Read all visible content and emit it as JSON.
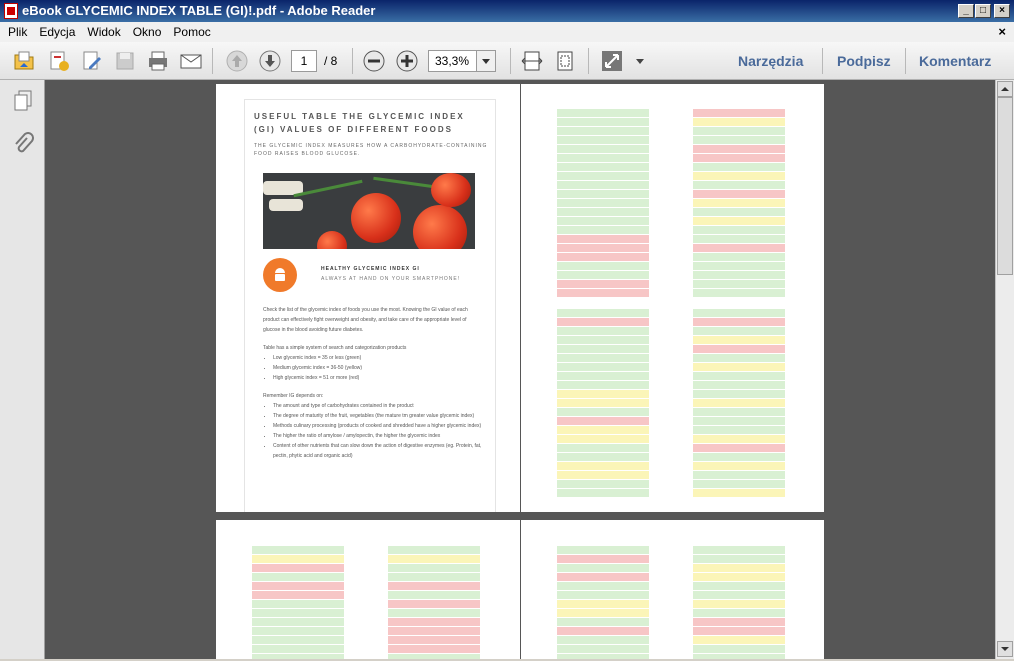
{
  "window": {
    "title": "eBook GLYCEMIC INDEX TABLE (GI)!.pdf - Adobe Reader",
    "minimize": "_",
    "maximize": "□",
    "close": "×"
  },
  "menu": {
    "items": [
      "Plik",
      "Edycja",
      "Widok",
      "Okno",
      "Pomoc"
    ],
    "doc_close": "×"
  },
  "toolbar": {
    "page_current": "1",
    "page_total": "/ 8",
    "zoom": "33,3%",
    "tools_label": "Narzędzia",
    "sign_label": "Podpisz",
    "comment_label": "Komentarz"
  },
  "icons": {
    "open": "open-icon",
    "create": "create-pdf-icon",
    "edit": "edit-icon",
    "save": "save-icon",
    "print": "print-icon",
    "email": "email-icon",
    "prev_page": "arrow-up-icon",
    "next_page": "arrow-down-icon",
    "zoom_out": "minus-icon",
    "zoom_in": "plus-icon",
    "fit_page": "fit-page-icon",
    "fit_width": "fit-width-icon",
    "fullscreen": "fullscreen-icon",
    "more": "chevron-down-icon",
    "pages_panel": "pages-icon",
    "attachments": "paperclip-icon"
  },
  "colors": {
    "green": "#d9f0d3",
    "yellow": "#fbf5b8",
    "red": "#f7c6c6",
    "accent": "#f07a2a",
    "link": "#4a6a9a"
  },
  "document": {
    "title": "USEFUL TABLE THE GLYCEMIC INDEX (GI) VALUES OF DIFFERENT FOODS",
    "subtitle": "THE GLYCEMIC INDEX MEASURES HOW A CARBOHYDRATE-CONTAINING FOOD RAISES BLOOD GLUCOSE.",
    "app_line1": "HEALTHY GLYCEMIC INDEX GI",
    "app_line2": "ALWAYS AT HAND ON YOUR SMARTPHONE!",
    "intro": "Check the list of the glycemic index of foods you use the most. Knowing the GI value of each product can effectively fight overweight and obesity, and take care of the appropriate level of glucose in the blood avoiding future diabetes.",
    "system_intro": "Table has a simple system of search and categorization products",
    "system_items": [
      "Low glycemic index = 35 or less (green)",
      "Medium glycemic index = 36-50 (yellow)",
      "High glycemic index = 51 or more (red)"
    ],
    "remember_intro": "Remember IG depends on:",
    "remember_items": [
      "The amount and type of carbohydrates contained in the product",
      "The degree of maturity of the fruit, vegetables (the mature tm greater value glycemic index)",
      "Methods culinary processing (products of cooked and shredded have a higher glycemic index)",
      "The higher the ratio of amylose / amylopectin, the higher the glycemic index",
      "Content of other nutrients that can slow down the action of digestive enzymes (eg. Protein, fat, pectin, phytic acid and organic acid)"
    ]
  },
  "tables": [
    {
      "id": "p2a",
      "rows": [
        "g",
        "g",
        "g",
        "g",
        "g",
        "g",
        "g",
        "g",
        "g",
        "g",
        "g",
        "g",
        "g",
        "g",
        "r",
        "r",
        "r",
        "g",
        "g",
        "r",
        "r"
      ]
    },
    {
      "id": "p2b",
      "rows": [
        "r",
        "y",
        "g",
        "g",
        "r",
        "r",
        "g",
        "y",
        "g",
        "r",
        "y",
        "g",
        "y",
        "g",
        "g",
        "r",
        "g",
        "g",
        "g",
        "g",
        "g"
      ]
    },
    {
      "id": "p3a",
      "rows": [
        "g",
        "r",
        "g",
        "g",
        "g",
        "g",
        "g",
        "g",
        "g",
        "y",
        "y",
        "g",
        "r",
        "y",
        "y",
        "g",
        "g",
        "y",
        "y",
        "g",
        "g"
      ]
    },
    {
      "id": "p3b",
      "rows": [
        "g",
        "r",
        "g",
        "y",
        "r",
        "g",
        "y",
        "g",
        "g",
        "g",
        "y",
        "g",
        "g",
        "g",
        "y",
        "r",
        "g",
        "y",
        "g",
        "g",
        "y"
      ]
    },
    {
      "id": "p4a",
      "rows": [
        "g",
        "y",
        "r",
        "g",
        "r",
        "r",
        "g",
        "g",
        "g",
        "g",
        "g",
        "g",
        "g"
      ]
    },
    {
      "id": "p4b",
      "rows": [
        "g",
        "y",
        "g",
        "g",
        "r",
        "g",
        "r",
        "g",
        "r",
        "r",
        "r",
        "r",
        "g"
      ]
    },
    {
      "id": "p5a",
      "rows": [
        "g",
        "r",
        "g",
        "r",
        "g",
        "g",
        "y",
        "y",
        "g",
        "r",
        "g",
        "g",
        "g"
      ]
    },
    {
      "id": "p5b",
      "rows": [
        "g",
        "g",
        "y",
        "y",
        "g",
        "g",
        "y",
        "g",
        "r",
        "r",
        "y",
        "g",
        "g"
      ]
    }
  ]
}
